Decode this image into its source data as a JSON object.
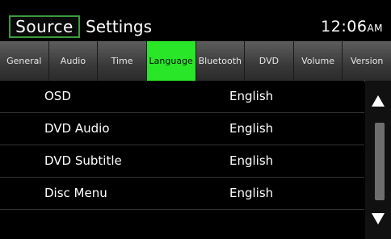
{
  "header": {
    "source_label": "Source",
    "title": "Settings",
    "time": "12:06",
    "ampm": "AM"
  },
  "tabs": [
    {
      "label": "General",
      "active": false
    },
    {
      "label": "Audio",
      "active": false
    },
    {
      "label": "Time",
      "active": false
    },
    {
      "label": "Language",
      "active": true
    },
    {
      "label": "Bluetooth",
      "active": false
    },
    {
      "label": "DVD",
      "active": false
    },
    {
      "label": "Volume",
      "active": false
    },
    {
      "label": "Version",
      "active": false
    }
  ],
  "rows": [
    {
      "name": "OSD",
      "value": "English"
    },
    {
      "name": "DVD Audio",
      "value": "English"
    },
    {
      "name": "DVD Subtitle",
      "value": "English"
    },
    {
      "name": "Disc Menu",
      "value": "English"
    }
  ],
  "scroll": {
    "up_icon": "triangle-up-icon",
    "down_icon": "triangle-down-icon"
  },
  "colors": {
    "accent": "#29e629",
    "source_border": "#3c9a3c"
  }
}
